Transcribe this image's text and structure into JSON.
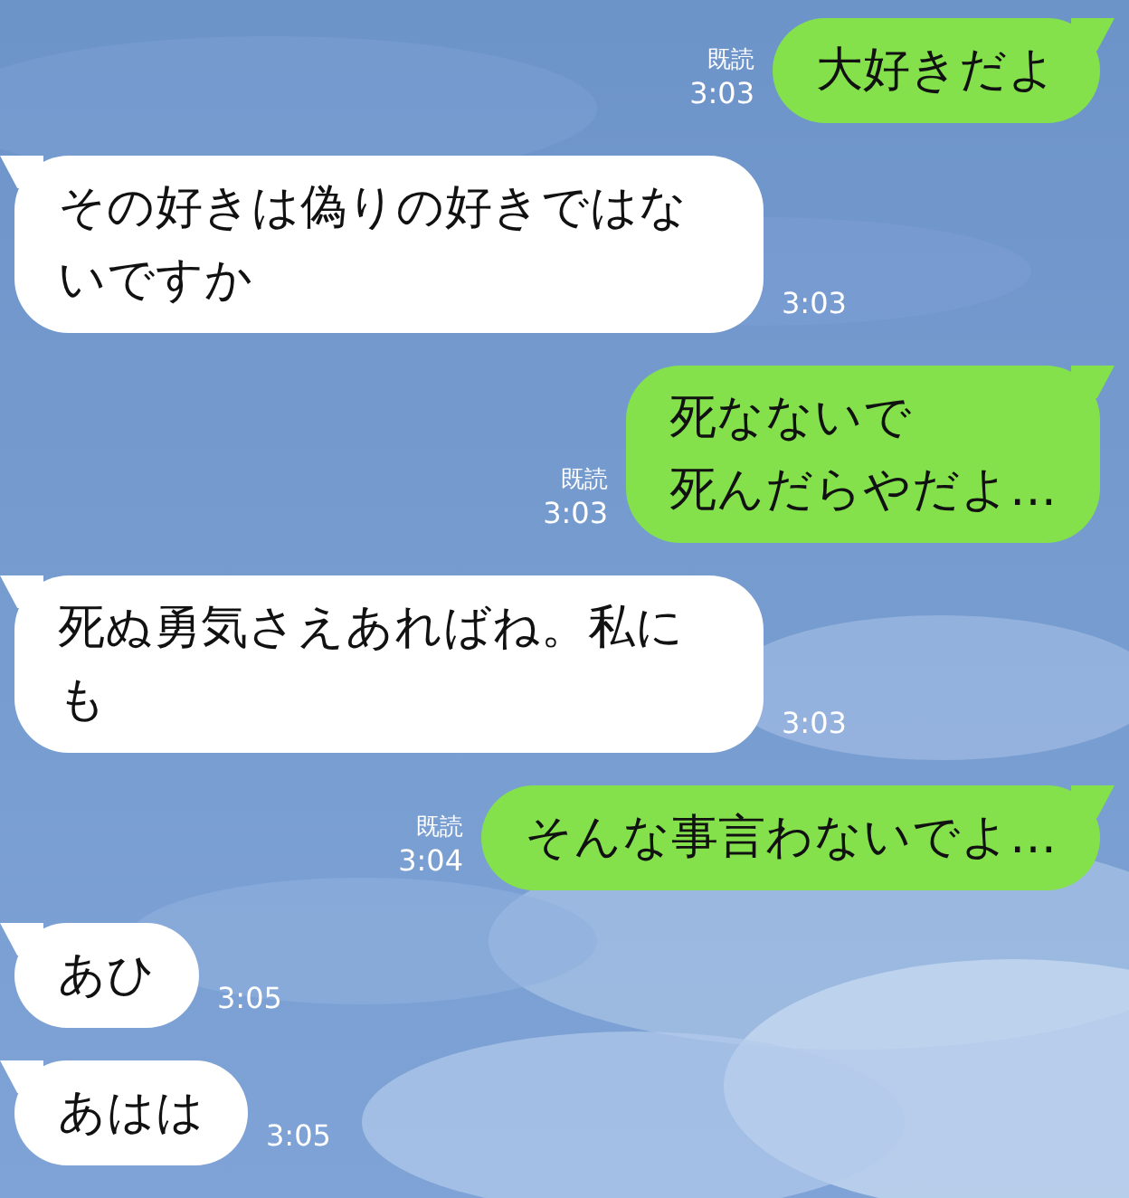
{
  "messages": [
    {
      "outgoing": true,
      "lines": [
        "大好きだよ"
      ],
      "read_label": "既読",
      "time": "3:03"
    },
    {
      "outgoing": false,
      "lines": [
        "その好きは偽りの好きではないですか"
      ],
      "time": "3:03"
    },
    {
      "outgoing": true,
      "lines": [
        "死なないで",
        "死んだらやだよ…"
      ],
      "read_label": "既読",
      "time": "3:03"
    },
    {
      "outgoing": false,
      "lines": [
        "死ぬ勇気さえあればね。私にも"
      ],
      "time": "3:03"
    },
    {
      "outgoing": true,
      "lines": [
        "そんな事言わないでよ…"
      ],
      "read_label": "既読",
      "time": "3:04"
    },
    {
      "outgoing": false,
      "lines": [
        "あひ"
      ],
      "time": "3:05"
    },
    {
      "outgoing": false,
      "lines": [
        "あはは"
      ],
      "time": "3:05"
    }
  ]
}
